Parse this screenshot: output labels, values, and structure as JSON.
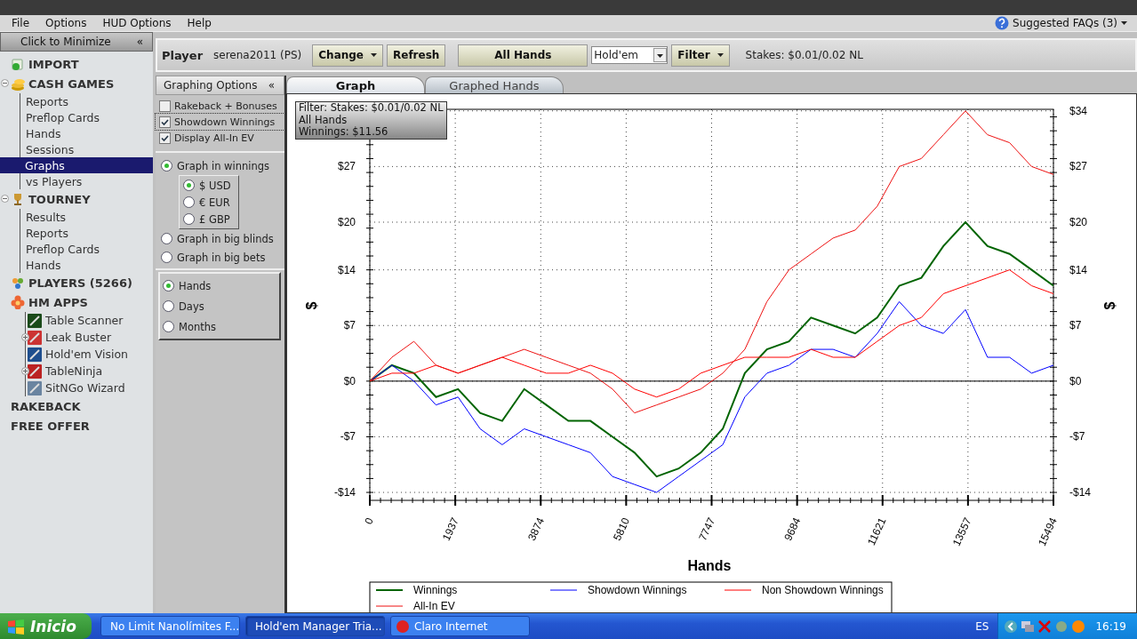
{
  "menu": [
    "File",
    "Options",
    "HUD Options",
    "Help"
  ],
  "faq": {
    "label": "Suggested FAQs (3)"
  },
  "sidebar": {
    "minimize": "Click to Minimize",
    "collapse": "«",
    "sections": [
      {
        "label": "IMPORT",
        "kind": "section"
      },
      {
        "label": "CASH GAMES",
        "kind": "section",
        "expanded": true,
        "children": [
          {
            "label": "Reports",
            "selected": false
          },
          {
            "label": "Preflop Cards",
            "selected": false
          },
          {
            "label": "Hands",
            "selected": false
          },
          {
            "label": "Sessions",
            "selected": false
          },
          {
            "label": "Graphs",
            "selected": true
          },
          {
            "label": "vs Players",
            "selected": false
          }
        ]
      },
      {
        "label": "TOURNEY",
        "kind": "section",
        "expanded": true,
        "children": [
          {
            "label": "Results",
            "selected": false
          },
          {
            "label": "Reports",
            "selected": false
          },
          {
            "label": "Preflop Cards",
            "selected": false
          },
          {
            "label": "Hands",
            "selected": false
          }
        ]
      },
      {
        "label": "PLAYERS (5266)",
        "kind": "section"
      },
      {
        "label": "HM APPS",
        "kind": "apps",
        "children": [
          {
            "label": "Table Scanner",
            "selected": false
          },
          {
            "label": "Leak Buster",
            "selected": false,
            "expanded": false
          },
          {
            "label": "Hold'em Vision",
            "selected": false
          },
          {
            "label": "TableNinja",
            "selected": false,
            "expanded": false
          },
          {
            "label": "SitNGo Wizard",
            "selected": false
          }
        ]
      },
      {
        "label": "RAKEBACK",
        "kind": "link"
      },
      {
        "label": "FREE OFFER",
        "kind": "link"
      }
    ]
  },
  "toolbar": {
    "player_label": "Player",
    "player": "serena2011 (PS)",
    "change": "Change",
    "refresh": "Refresh",
    "all_hands": "All Hands",
    "game": "Hold'em",
    "filter": "Filter",
    "stakes": "Stakes: $0.01/0.02 NL"
  },
  "options": {
    "title": "Graphing Options",
    "collapse": "«",
    "checkboxes": [
      {
        "label": "Rakeback + Bonuses",
        "checked": false
      },
      {
        "label": "Showdown Winnings",
        "checked": true
      },
      {
        "label": "Display All-In EV",
        "checked": true
      }
    ],
    "units": [
      {
        "label": "Graph in winnings",
        "selected": true,
        "currencies": [
          {
            "label": "$ USD",
            "selected": true
          },
          {
            "label": "€ EUR",
            "selected": false
          },
          {
            "label": "£ GBP",
            "selected": false
          }
        ]
      },
      {
        "label": "Graph in big blinds",
        "selected": false
      },
      {
        "label": "Graph in big bets",
        "selected": false
      }
    ],
    "periods": [
      {
        "label": "Hands",
        "selected": true
      },
      {
        "label": "Days",
        "selected": false
      },
      {
        "label": "Months",
        "selected": false
      }
    ]
  },
  "tabs": [
    {
      "label": "Graph",
      "selected": true
    },
    {
      "label": "Graphed Hands",
      "selected": false
    }
  ],
  "info": [
    "Filter: Stakes: $0.01/0.02 NL",
    "All Hands",
    "Winnings: $11.56"
  ],
  "chart_data": {
    "type": "line",
    "grid": true,
    "legend": true,
    "xlabel": "Hands",
    "ylabel": "$",
    "xlim": [
      0,
      15494
    ],
    "ylim": [
      -15,
      34.2
    ],
    "xticks": [
      0,
      1937,
      3874,
      5810,
      7747,
      9684,
      11621,
      13557,
      15494
    ],
    "yticks": [
      {
        "value": -14,
        "label": "-$14"
      },
      {
        "value": -7,
        "label": "-$7"
      },
      {
        "value": 0,
        "label": "$0"
      },
      {
        "value": 7,
        "label": "$7"
      },
      {
        "value": 14,
        "label": "$14"
      },
      {
        "value": 20,
        "label": "$20"
      },
      {
        "value": 27,
        "label": "$27"
      },
      {
        "value": 34,
        "label": "$34"
      }
    ],
    "x": [
      0,
      500,
      1000,
      1500,
      2000,
      2500,
      3000,
      3500,
      4000,
      4500,
      5000,
      5500,
      6000,
      6500,
      7000,
      7500,
      8000,
      8500,
      9000,
      9500,
      10000,
      10500,
      11000,
      11500,
      12000,
      12500,
      13000,
      13500,
      14000,
      14500,
      15000,
      15494
    ],
    "series": [
      {
        "name": "Winnings",
        "color": "#006400",
        "values": [
          0,
          2,
          1,
          -2,
          -1,
          -4,
          -5,
          -1,
          -3,
          -5,
          -5,
          -7,
          -9,
          -12,
          -11,
          -9,
          -6,
          1,
          4,
          5,
          8,
          7,
          6,
          8,
          12,
          13,
          17,
          20,
          17,
          16,
          14,
          12
        ]
      },
      {
        "name": "Showdown Winnings",
        "color": "#0000ff",
        "values": [
          0,
          2,
          0,
          -3,
          -2,
          -6,
          -8,
          -6,
          -7,
          -8,
          -9,
          -12,
          -13,
          -14,
          -12,
          -10,
          -8,
          -2,
          1,
          2,
          4,
          4,
          3,
          6,
          10,
          7,
          6,
          9,
          3,
          3,
          1,
          2
        ]
      },
      {
        "name": "Non Showdown Winnings",
        "color": "#ff0000",
        "values": [
          0,
          1,
          1,
          2,
          1,
          2,
          3,
          2,
          1,
          1,
          2,
          1,
          -1,
          -2,
          -1,
          1,
          2,
          3,
          3,
          3,
          4,
          3,
          3,
          5,
          7,
          8,
          11,
          12,
          13,
          14,
          12,
          11
        ]
      },
      {
        "name": "All-In EV",
        "color": "#ee1111",
        "values": [
          0,
          3,
          5,
          2,
          1,
          2,
          3,
          4,
          3,
          2,
          1,
          -1,
          -4,
          -3,
          -2,
          -1,
          1,
          4,
          10,
          14,
          16,
          18,
          19,
          22,
          27,
          28,
          31,
          34,
          31,
          30,
          27,
          26
        ]
      }
    ]
  },
  "taskbar": {
    "start": "Inicio",
    "tasks": [
      {
        "label": "No Limit Nanolímites F...",
        "selected": false
      },
      {
        "label": "Hold'em Manager Tria...",
        "selected": true
      },
      {
        "label": "Claro Internet",
        "selected": false
      }
    ],
    "lang": "ES",
    "clock": "16:19"
  }
}
